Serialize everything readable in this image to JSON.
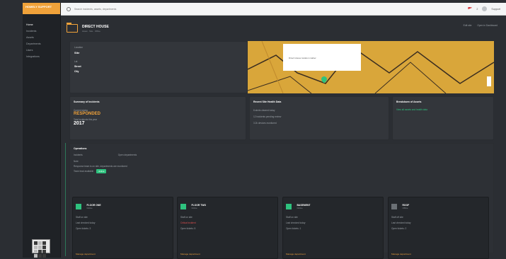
{
  "sidebar": {
    "logo": "HOMELY SUPPORT",
    "items": [
      {
        "label": "Home",
        "active": true
      },
      {
        "label": "Incidents",
        "active": false
      },
      {
        "label": "Assets",
        "active": false
      },
      {
        "label": "Departments",
        "active": false
      },
      {
        "label": "Users",
        "active": false
      },
      {
        "label": "Integrations",
        "active": false
      }
    ]
  },
  "topbar": {
    "search_placeholder": "Search incidents, assets, departments",
    "alert_count": "2",
    "user_label": "Support"
  },
  "header": {
    "title": "DIRECT HOUSE",
    "subtitle": "Asset · Site · Office",
    "links": [
      "Edit site",
      "Open in Dashboard"
    ]
  },
  "location": {
    "label": "Location",
    "line1": "Site",
    "field1": "Lat",
    "field2": "Street",
    "field3": "City"
  },
  "map": {
    "popup_text": "Direct House location marker"
  },
  "incident_card": {
    "title": "Summary of Incidents",
    "status_label": "Current status",
    "status_value": "RESPONDED",
    "count_label": "Total incidents this year",
    "count_value": "2017"
  },
  "health_card": {
    "title": "Recent Site Health Data",
    "lines": [
      "8 alerts cleared today",
      "12 incidents pending review",
      "3.2k devices monitored"
    ]
  },
  "breakdown_card": {
    "title": "Breakdown of Assets",
    "link": "View all assets and health data"
  },
  "operations": {
    "title": "Operations",
    "tab1": "Incidents",
    "tab2": "Open departments",
    "note_label": "Note",
    "note_line": "Response team is on site, departments are monitored",
    "tag": "Active",
    "secondary_line": "Team lead available"
  },
  "departments": [
    {
      "name": "FLOOR ONE",
      "status": "Online",
      "icon": "check",
      "lines": [
        "Staff on site",
        "Last checked today",
        "Open tickets: 3"
      ],
      "footer": "Manage department"
    },
    {
      "name": "FLOOR TWO",
      "status": "Online",
      "icon": "check",
      "lines": [
        "Staff on site",
        "Critical incident",
        "Open tickets: 5"
      ],
      "footer": "Manage department"
    },
    {
      "name": "BASEMENT",
      "status": "Online",
      "icon": "check",
      "lines": [
        "Staff on site",
        "Last checked today",
        "Open tickets: 1"
      ],
      "footer": "Manage department"
    },
    {
      "name": "ROOF",
      "status": "Offline",
      "icon": "minus",
      "lines": [
        "Staff off site",
        "Last checked today",
        "Open tickets: 2"
      ],
      "footer": "Manage department"
    }
  ]
}
